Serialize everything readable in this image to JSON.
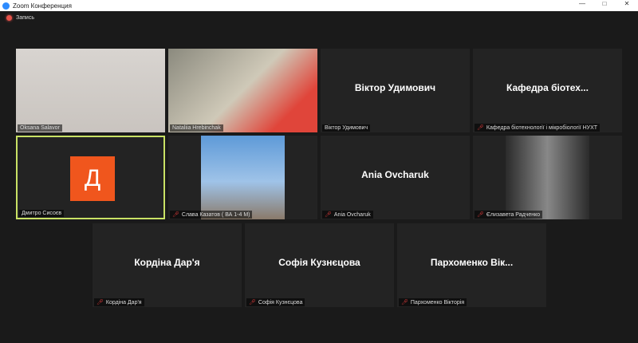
{
  "window": {
    "title": "Zoom Конференция",
    "buttons": [
      "—",
      "□",
      "✕"
    ]
  },
  "recording": {
    "label": "Запись"
  },
  "participants": [
    {
      "display": "",
      "label": "Oksana Salavor",
      "muted": false,
      "video": true
    },
    {
      "display": "",
      "label": "Nataliia Hrebinchak",
      "muted": false,
      "video": true
    },
    {
      "display": "Віктор Удимович",
      "label": "Віктор Удимович",
      "muted": false,
      "video": false
    },
    {
      "display": "Кафедра біотех...",
      "label": "Кафедра біотехнології і мікробіології НУХТ",
      "muted": true,
      "video": false
    },
    {
      "display": "",
      "label": "Дмитро Сисоєв",
      "muted": false,
      "video": false,
      "avatar": "Д"
    },
    {
      "display": "",
      "label": "Слава Казатов ( ВА 1-4 M)",
      "muted": true,
      "video": true
    },
    {
      "display": "Ania Ovcharuk",
      "label": "Ania Ovcharuk",
      "muted": true,
      "video": false
    },
    {
      "display": "",
      "label": "Єлизавета Радченко",
      "muted": true,
      "video": true
    },
    {
      "display": "Кордіна Дар'я",
      "label": "Кордіна Дар'я",
      "muted": true,
      "video": false
    },
    {
      "display": "Софія Кузнєцова",
      "label": "Софія Кузнєцова",
      "muted": true,
      "video": false
    },
    {
      "display": "Пархоменко Вік...",
      "label": "Пархоменко Вікторія",
      "muted": true,
      "video": false
    }
  ],
  "colors": {
    "active_border": "#c9e265",
    "avatar": "#f0561d",
    "muted": "#e03b3b"
  }
}
